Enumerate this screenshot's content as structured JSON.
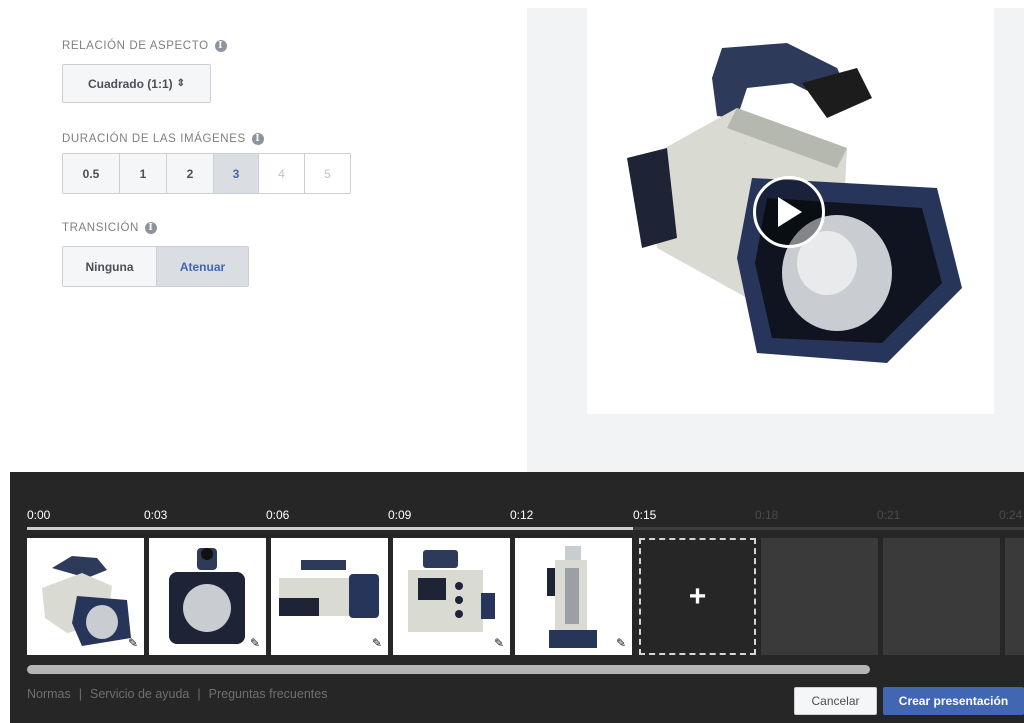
{
  "settings": {
    "aspect": {
      "label": "RELACIÓN DE ASPECTO",
      "value": "Cuadrado (1:1)",
      "chevron": "⇕"
    },
    "duration": {
      "label": "DURACIÓN DE LAS IMÁGENES",
      "options": [
        "0.5",
        "1",
        "2",
        "3",
        "4",
        "5"
      ],
      "selected": "3",
      "disabled": [
        "4",
        "5"
      ]
    },
    "transition": {
      "label": "TRANSICIÓN",
      "options": [
        "Ninguna",
        "Atenuar"
      ],
      "selected": "Atenuar"
    }
  },
  "preview": {
    "play_icon": "play-icon"
  },
  "timeline": {
    "ticks": [
      "0:00",
      "0:03",
      "0:06",
      "0:09",
      "0:12",
      "0:15",
      "0:18",
      "0:21",
      "0:24"
    ],
    "dim_ticks": [
      "0:18",
      "0:21",
      "0:24"
    ],
    "progress_fraction": 0.61,
    "thumbnails": [
      "camera-angle",
      "camera-front",
      "camera-side",
      "camera-back",
      "camera-vertical"
    ],
    "add_label": "+",
    "empty_slots": 3
  },
  "footer": {
    "links": [
      "Normas",
      "Servicio de ayuda",
      "Preguntas frecuentes"
    ],
    "cancel_label": "Cancelar",
    "create_label": "Crear presentación"
  },
  "colors": {
    "accent": "#4267b2",
    "timeline_bg": "#262626"
  }
}
